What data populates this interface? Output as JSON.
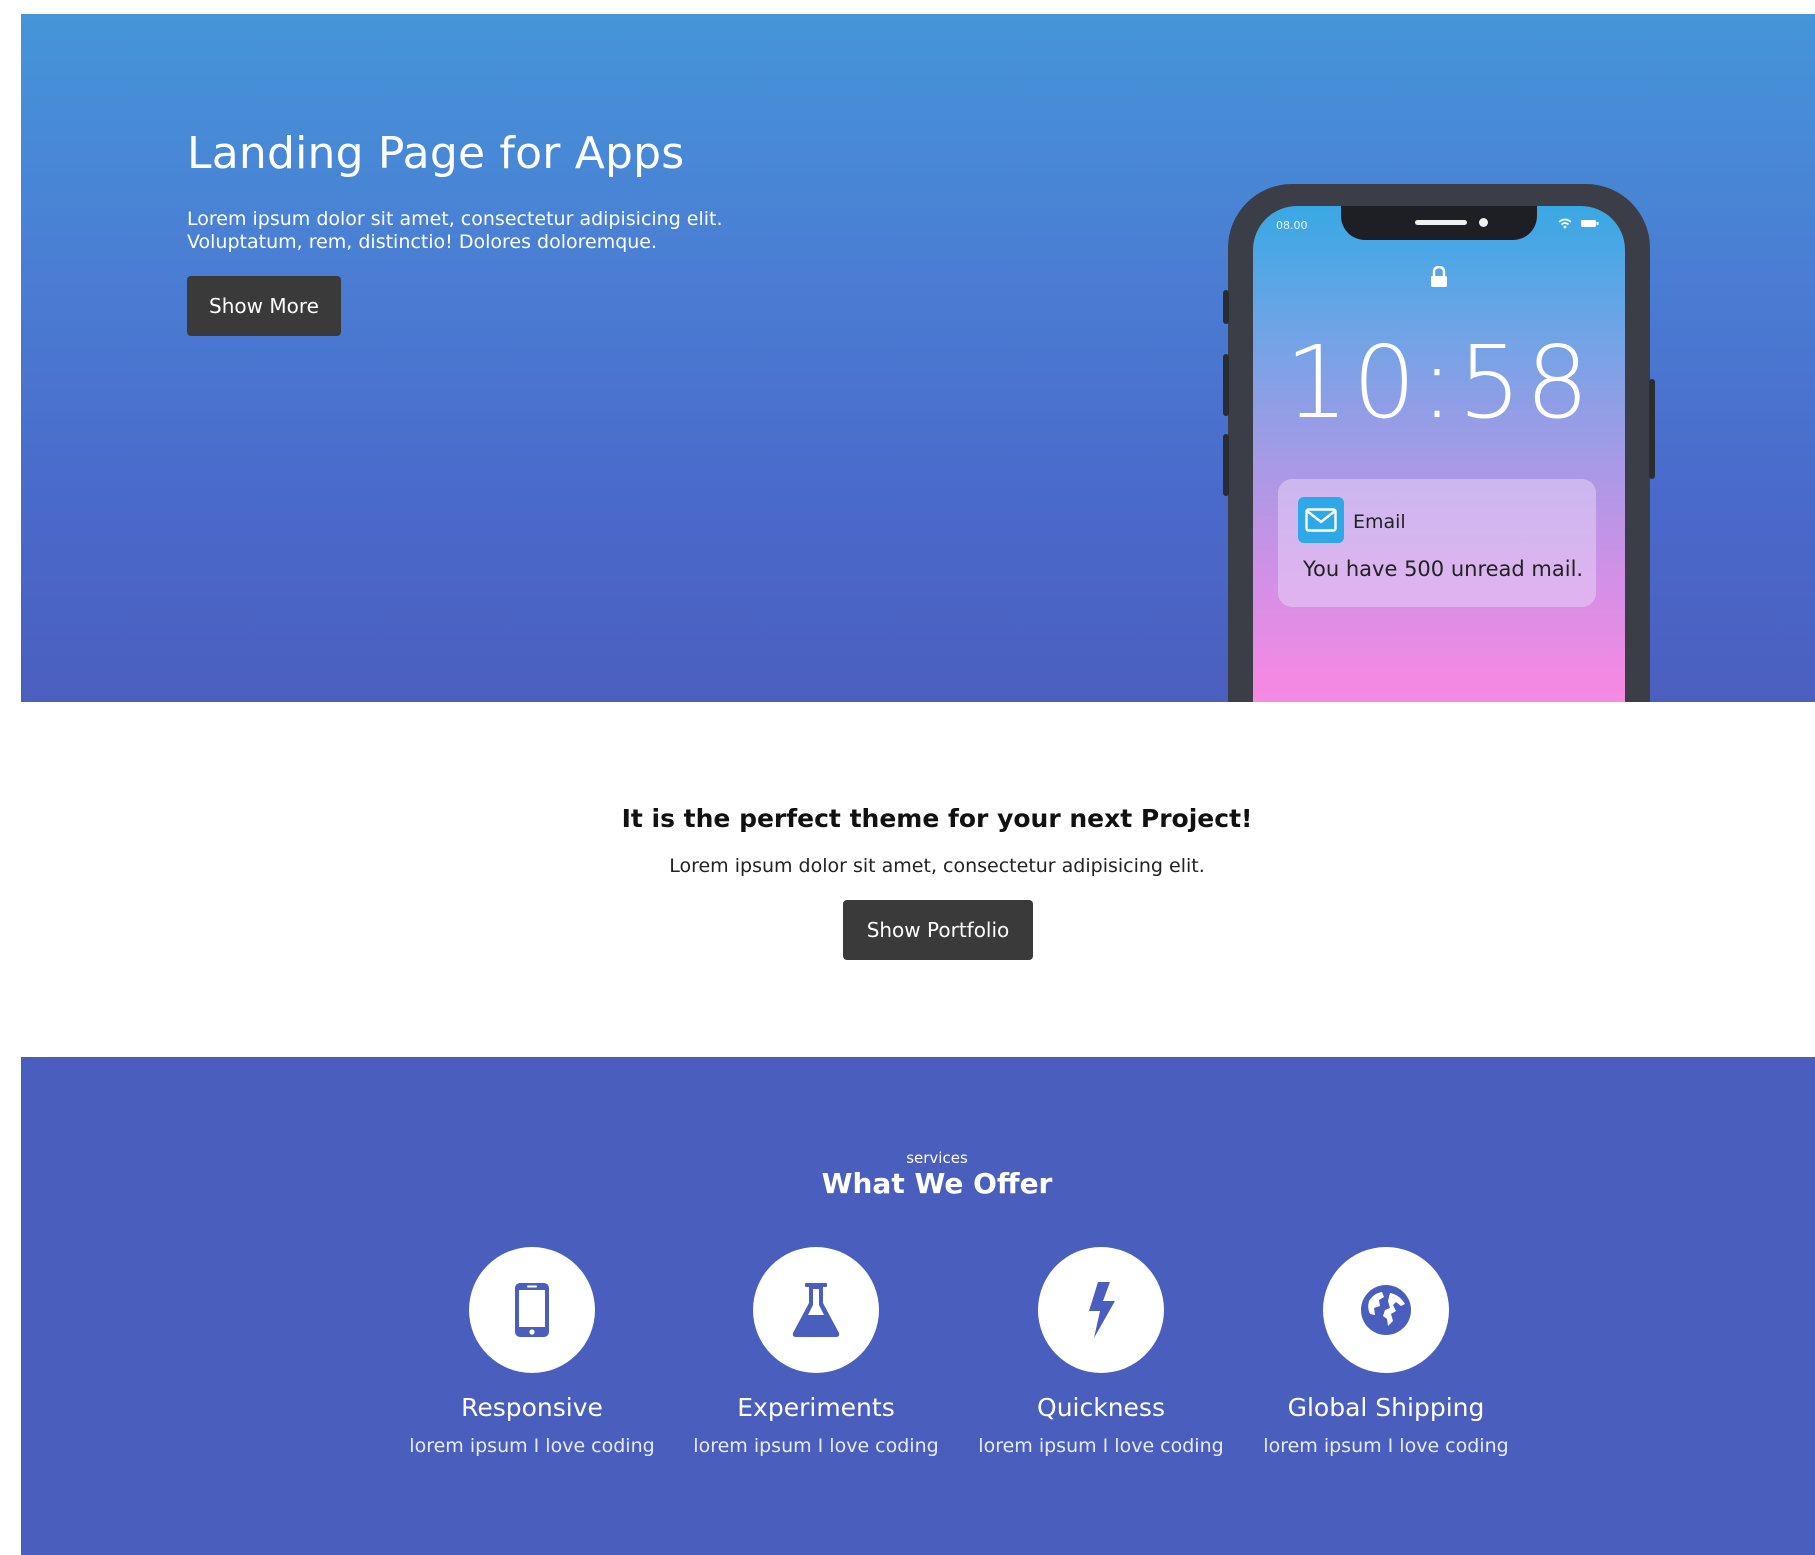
{
  "hero": {
    "title": "Landing Page for Apps",
    "text_line1": "Lorem ipsum dolor sit amet, consectetur adipisicing elit.",
    "text_line2": "Voluptatum, rem, distinctio! Dolores doloremque.",
    "button_label": "Show More"
  },
  "phone": {
    "status_time": "08.00",
    "clock": "10:58",
    "notification": {
      "app": "Email",
      "message": "You have 500 unread mail."
    }
  },
  "middle": {
    "title": "It is the perfect theme for your next Project!",
    "text": "Lorem ipsum dolor sit amet, consectetur adipisicing elit.",
    "button_label": "Show Portfolio"
  },
  "services": {
    "kicker": "services",
    "title": "What We Offer",
    "items": [
      {
        "icon": "mobile-phone-icon",
        "name": "Responsive",
        "desc": "lorem ipsum I love coding"
      },
      {
        "icon": "flask-icon",
        "name": "Experiments",
        "desc": "lorem ipsum I love coding"
      },
      {
        "icon": "lightning-bolt-icon",
        "name": "Quickness",
        "desc": "lorem ipsum I love coding"
      },
      {
        "icon": "globe-icon",
        "name": "Global Shipping",
        "desc": "lorem ipsum I love coding"
      }
    ]
  },
  "colors": {
    "hero_top": "#4595d8",
    "hero_bottom": "#4b5fbf",
    "services_bg": "#4a5ebe",
    "button_dark": "#3a3a3a"
  }
}
